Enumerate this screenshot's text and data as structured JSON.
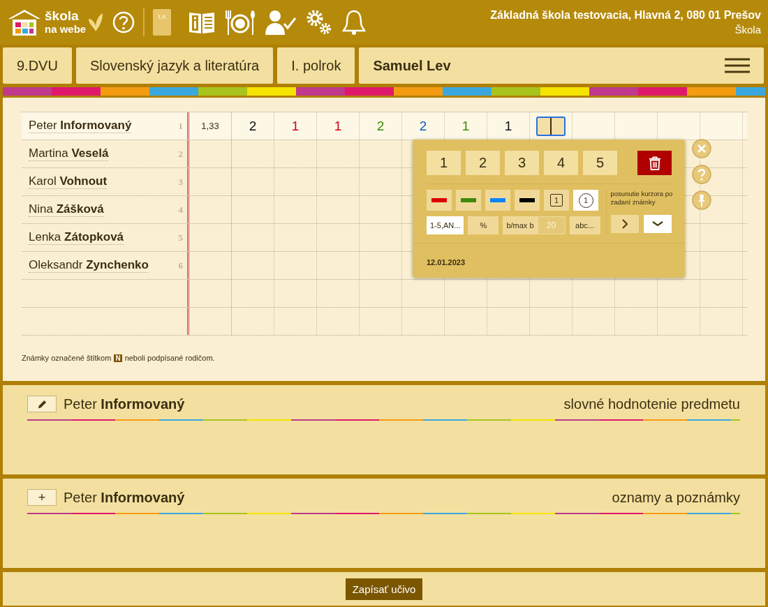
{
  "topbar": {
    "logo": {
      "line1": "škola",
      "line2": "na webe"
    },
    "book_label": "I.A",
    "school": "Základná škola testovacia, Hlavná 2, 080 01 Prešov",
    "role": "Škola"
  },
  "header": {
    "class": "9.DVU",
    "subject": "Slovenský jazyk a literatúra",
    "term": "I. polrok",
    "teacher": "Samuel Lev"
  },
  "students": [
    {
      "first": "Peter",
      "last": "Informovaný",
      "number": "1",
      "selected": true,
      "average": "1,33",
      "cells": [
        {
          "kind": "grade",
          "text": "2",
          "color": "#111111"
        },
        {
          "kind": "grade",
          "text": "1",
          "color": "#d0021b"
        },
        {
          "kind": "grade",
          "text": "1",
          "color": "#d0021b"
        },
        {
          "kind": "grade",
          "text": "2",
          "color": "#3a8c0a"
        },
        {
          "kind": "grade",
          "text": "2",
          "color": "#0a5fc4"
        },
        {
          "kind": "grade",
          "text": "1",
          "color": "#3a8c0a"
        },
        {
          "kind": "grade",
          "text": "1",
          "color": "#111111"
        },
        {
          "kind": "cursor"
        }
      ]
    },
    {
      "first": "Martina",
      "last": "Veselá",
      "number": "2",
      "selected": false
    },
    {
      "first": "Karol",
      "last": "Vohnout",
      "number": "3",
      "selected": false
    },
    {
      "first": "Nina",
      "last": "Zášková",
      "number": "4",
      "selected": false
    },
    {
      "first": "Lenka",
      "last": "Zátopková",
      "number": "5",
      "selected": false
    },
    {
      "first": "Oleksandr",
      "last": "Zynchenko",
      "number": "6",
      "selected": false
    }
  ],
  "legend": {
    "before": "Známky označené štítkom",
    "badge": "N",
    "after": "neboli podpísané rodičom."
  },
  "popup": {
    "grades": [
      "1",
      "2",
      "3",
      "4",
      "5"
    ],
    "colors": [
      {
        "color": "#dd0000",
        "selected": false
      },
      {
        "color": "#3f8a0a",
        "selected": false
      },
      {
        "color": "#0a84ff",
        "selected": false
      },
      {
        "color": "#000000",
        "selected": false
      }
    ],
    "styles": [
      {
        "kind": "square",
        "text": "1",
        "selected": false
      },
      {
        "kind": "circle",
        "text": "1",
        "selected": true
      }
    ],
    "modes": [
      {
        "kind": "plain",
        "text": "1-5,AN...",
        "selected": true
      },
      {
        "kind": "plain",
        "text": "%",
        "selected": false
      },
      {
        "kind": "points",
        "text": "b/max b",
        "value": "20",
        "selected": false
      },
      {
        "kind": "plain",
        "text": "abc...",
        "selected": false
      }
    ],
    "cursor_label": "posunutie kurzora po zadaní známky",
    "cursor_moves": [
      {
        "kind": "right",
        "selected": false
      },
      {
        "kind": "down",
        "selected": true
      }
    ],
    "date": "12.01.2023"
  },
  "sections": [
    {
      "kind": "edit",
      "first": "Peter",
      "last": "Informovaný",
      "title": "slovné hodnotenie predmetu"
    },
    {
      "kind": "add",
      "button": "+",
      "first": "Peter",
      "last": "Informovaný",
      "title": "oznamy a poznámky"
    }
  ],
  "footer_button": "Zapísať učivo"
}
